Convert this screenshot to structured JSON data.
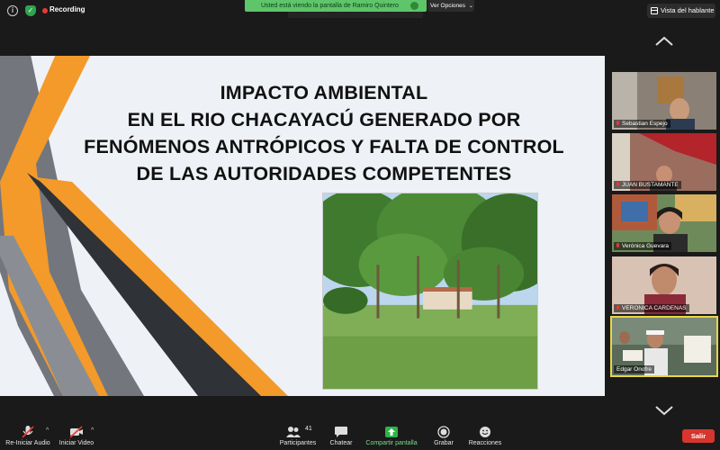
{
  "topbar": {
    "recording_label": "Recording",
    "share_banner_text": "Usted está viendo la pantalla de Ramiro Quintero",
    "options_label": "Ver Opciones",
    "speaker_view_label": "Vista del hablante"
  },
  "slide": {
    "title_lines": [
      "IMPACTO AMBIENTAL",
      "EN EL RIO CHACAYACÚ GENERADO POR",
      "FENÓMENOS ANTRÓPICOS Y FALTA DE CONTROL",
      "DE LAS AUTORIDADES COMPETENTES"
    ]
  },
  "participants": [
    {
      "name": "Sebastian Espejo"
    },
    {
      "name": "JUAN BUSTAMANTE"
    },
    {
      "name": "Verónica Guevara"
    },
    {
      "name": "VERONICA CARDENAS"
    },
    {
      "name": "Edgar Onofre"
    }
  ],
  "toolbar": {
    "audio_label": "Re-Iniciar Audio",
    "video_label": "Iniciar Video",
    "participants_label": "Participantes",
    "participants_count": "41",
    "chat_label": "Chatear",
    "share_label": "Compartir pantalla",
    "record_label": "Grabar",
    "reactions_label": "Reacciones",
    "leave_label": "Salir"
  },
  "colors": {
    "accent_green": "#5ec56a",
    "leave_red": "#d6362d",
    "active_speaker": "#e8d54a",
    "slide_orange": "#f39a2a",
    "slide_gray": "#6b6f75"
  }
}
